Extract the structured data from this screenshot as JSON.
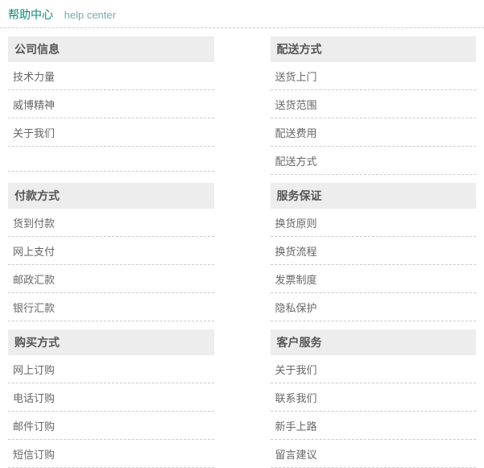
{
  "header": {
    "title_cn": "帮助中心",
    "title_en": "help center"
  },
  "sections": [
    {
      "left": {
        "title": "公司信息",
        "items": [
          "技术力量",
          "威博精神",
          "关于我们"
        ]
      },
      "right": {
        "title": "配送方式",
        "items": [
          "送货上门",
          "送货范围",
          "配送费用",
          "配送方式"
        ]
      }
    },
    {
      "left": {
        "title": "付款方式",
        "items": [
          "货到付款",
          "网上支付",
          "邮政汇款",
          "银行汇款"
        ]
      },
      "right": {
        "title": "服务保证",
        "items": [
          "换货原则",
          "换货流程",
          "发票制度",
          "隐私保护"
        ]
      }
    },
    {
      "left": {
        "title": "购买方式",
        "items": [
          "网上订购",
          "电话订购",
          "邮件订购",
          "短信订购"
        ]
      },
      "right": {
        "title": "客户服务",
        "items": [
          "关于我们",
          "联系我们",
          "新手上路",
          "留言建议"
        ]
      }
    }
  ]
}
